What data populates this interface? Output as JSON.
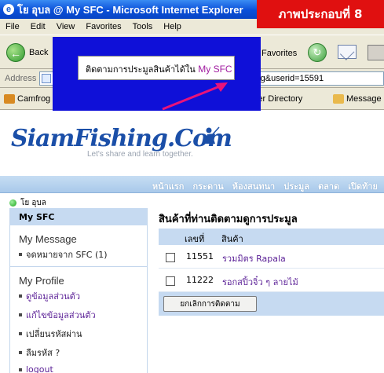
{
  "window": {
    "title": "โย อุบล @ My SFC - Microsoft Internet Explorer",
    "caption": "ภาพประกอบที่ 8"
  },
  "menu": [
    "File",
    "Edit",
    "View",
    "Favorites",
    "Tools",
    "Help"
  ],
  "toolbar": {
    "back_label": "Back",
    "favorites_label": "Favorites"
  },
  "address": {
    "label": "Address",
    "value_fragment": "hing&userid=15591"
  },
  "links": [
    {
      "label": "Camfrog",
      "icon": "camfrog-icon"
    },
    {
      "label": "User Directory",
      "icon": "user-directory-icon"
    },
    {
      "label": "Message",
      "icon": "message-icon"
    }
  ],
  "callout": {
    "text_prefix": "ติดตามการประมูลสินค้าได้ใน ",
    "text_highlight": "My SFC"
  },
  "site": {
    "logo": "SiamFishing.Com",
    "tagline": "Let's share and learn together.",
    "nav": [
      "หน้าแรก",
      "กระดาน",
      "ห้องสนทนา",
      "ประมูล",
      "ตลาด",
      "เปิดท้าย"
    ]
  },
  "user": {
    "name": "โย อุบล"
  },
  "sidebar": {
    "header": "My SFC",
    "message_title": "My Message",
    "message_link": "จดหมายจาก SFC (1)",
    "profile_title": "My Profile",
    "profile_links": [
      "ดูข้อมูลส่วนตัว",
      "แก้ไขข้อมูลส่วนตัว",
      "เปลี่ยนรหัสผ่าน",
      "ลืมรหัส ?",
      "logout"
    ]
  },
  "main": {
    "title": "สินค้าที่ท่านติดตามดูการประมูล",
    "col_number": "เลขที่",
    "col_product": "สินค้า",
    "rows": [
      {
        "id": "11551",
        "name": "รวมมิตร Rapala"
      },
      {
        "id": "11222",
        "name": "รอกสปิ้วจิ๋ว ๆ ลายไม้"
      }
    ],
    "cancel_button": "ยกเลิกการติดตาม"
  },
  "colors": {
    "accent": "#1b4fa8",
    "caption_bg": "#e01010",
    "callout_bg": "#0f10d8",
    "link_purple": "#5a1f96"
  }
}
